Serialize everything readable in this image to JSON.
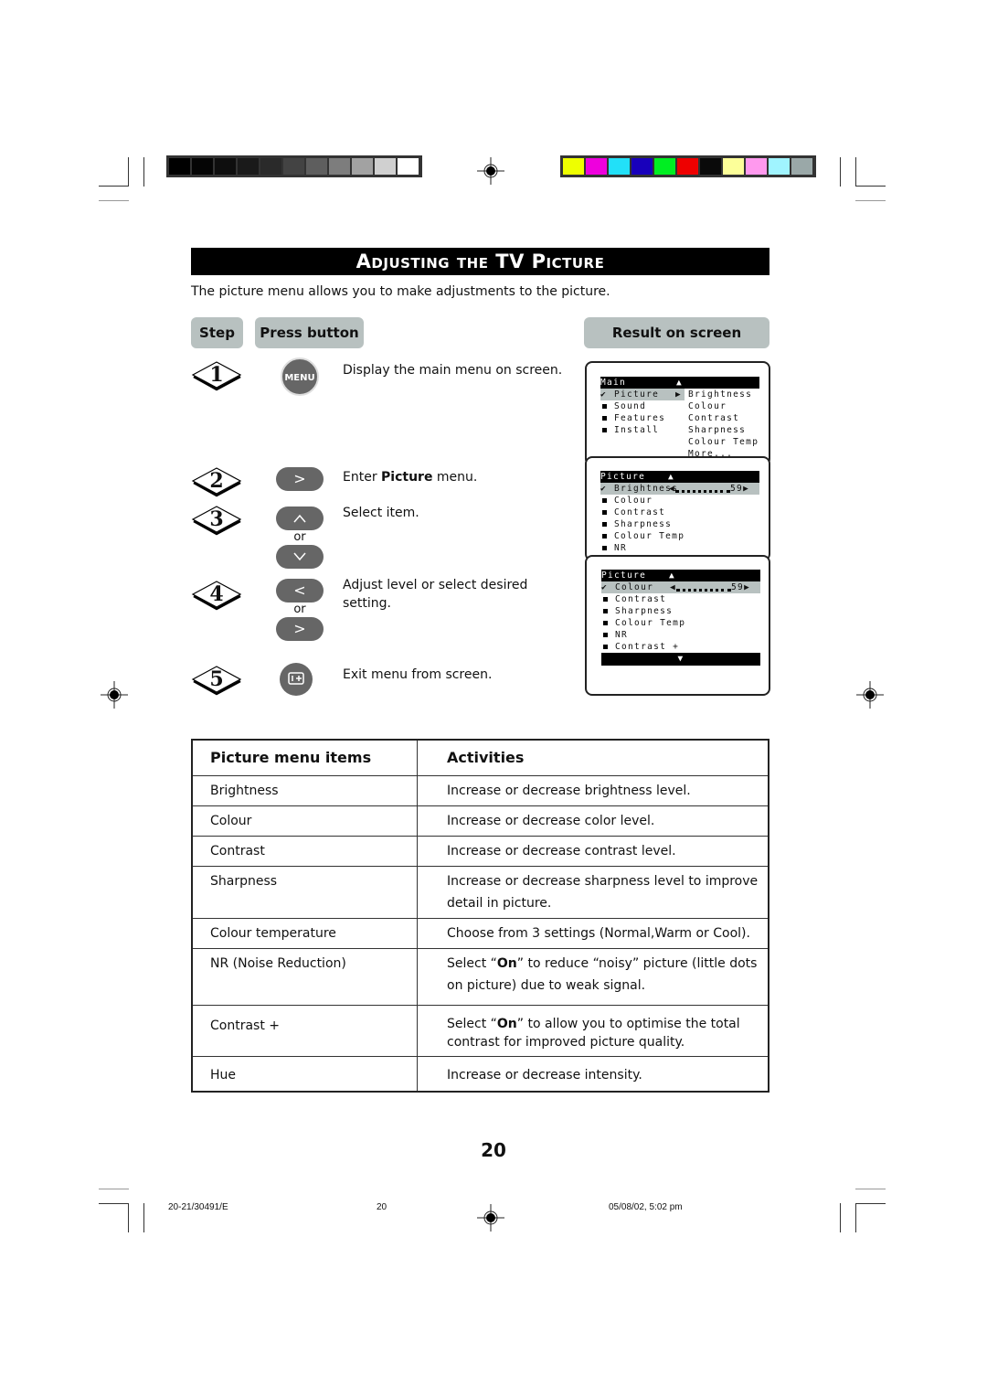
{
  "colors": {
    "grayscale_bars": [
      "#000000",
      "#050505",
      "#0e0e0e",
      "#1a1a1a",
      "#2a2a2a",
      "#434343",
      "#5e5e5e",
      "#7d7d7d",
      "#a2a2a2",
      "#d0d0d0",
      "#ffffff"
    ],
    "color_bars": [
      "#eeff00",
      "#ee00dd",
      "#22e0f8",
      "#1800bb",
      "#00ee22",
      "#ee0000",
      "#0a0a0a",
      "#fcff99",
      "#ff99ee",
      "#a0f4ff",
      "#9aa8a8"
    ],
    "pill_bg": "#b8c1c0",
    "button_bg": "#666666"
  },
  "header": {
    "title": "Adjusting the TV Picture",
    "intro": "The picture menu allows you to make adjustments to the picture."
  },
  "columns": {
    "step": "Step",
    "press_button": "Press button",
    "result": "Result on screen"
  },
  "steps": [
    {
      "num": "1",
      "button": "MENU",
      "button_icon": "menu-button",
      "text": "Display the main menu on screen."
    },
    {
      "num": "2",
      "button_icon": "right-arrow-button",
      "button_glyph": ">",
      "text_pre": "Enter ",
      "text_bold": "Picture",
      "text_post": " menu."
    },
    {
      "num": "3",
      "button_icon": "up-down-buttons",
      "up_glyph": "^",
      "down_glyph": "v",
      "or": "or",
      "text": "Select item."
    },
    {
      "num": "4",
      "button_icon": "left-right-buttons",
      "left_glyph": "<",
      "right_glyph": ">",
      "or": "or",
      "text": "Adjust level or select desired setting."
    },
    {
      "num": "5",
      "button_icon": "exit-osd-button",
      "text": "Exit menu from screen."
    }
  ],
  "screens": {
    "main": {
      "header": "Main",
      "up_arrow": "▲",
      "items": [
        "Picture",
        "Sound",
        "Features",
        "Install"
      ],
      "selected": "Picture",
      "sub_items": [
        "Brightness",
        "Colour",
        "Contrast",
        "Sharpness",
        "Colour Temp",
        "More..."
      ]
    },
    "picture1": {
      "header": "Picture",
      "up_arrow": "▲",
      "selected": "Brightness",
      "value": "59",
      "items": [
        "Colour",
        "Contrast",
        "Sharpness",
        "Colour Temp",
        "NR"
      ]
    },
    "picture2": {
      "header": "Picture",
      "up_arrow": "▲",
      "down_arrow": "▼",
      "selected": "Colour",
      "value": "59",
      "items": [
        "Contrast",
        "Sharpness",
        "Colour Temp",
        "NR",
        "Contrast +"
      ]
    }
  },
  "table": {
    "headers": [
      "Picture menu items",
      "Activities"
    ],
    "rows": [
      {
        "item": "Brightness",
        "activity": "Increase or decrease brightness level."
      },
      {
        "item": "Colour",
        "activity": "Increase or decrease color level."
      },
      {
        "item": "Contrast",
        "activity": "Increase or decrease contrast level."
      },
      {
        "item": "Sharpness",
        "activity": "Increase or decrease sharpness level to improve detail in picture."
      },
      {
        "item": "Colour temperature",
        "activity": "Choose from 3 settings (Normal,Warm or Cool)."
      },
      {
        "item": "NR (Noise Reduction)",
        "activity_pre": "Select “",
        "activity_bold": "On",
        "activity_post": "” to reduce “noisy” picture (little dots on picture) due to weak signal."
      },
      {
        "item": "Contrast +",
        "activity_pre": "Select “",
        "activity_bold": "On",
        "activity_post": "” to allow you to optimise the total contrast for improved picture quality."
      },
      {
        "item": "Hue",
        "activity": "Increase or decrease intensity."
      }
    ]
  },
  "page_number": "20",
  "footer": {
    "left": "20-21/30491/E",
    "center": "20",
    "right": "05/08/02, 5:02 pm"
  }
}
